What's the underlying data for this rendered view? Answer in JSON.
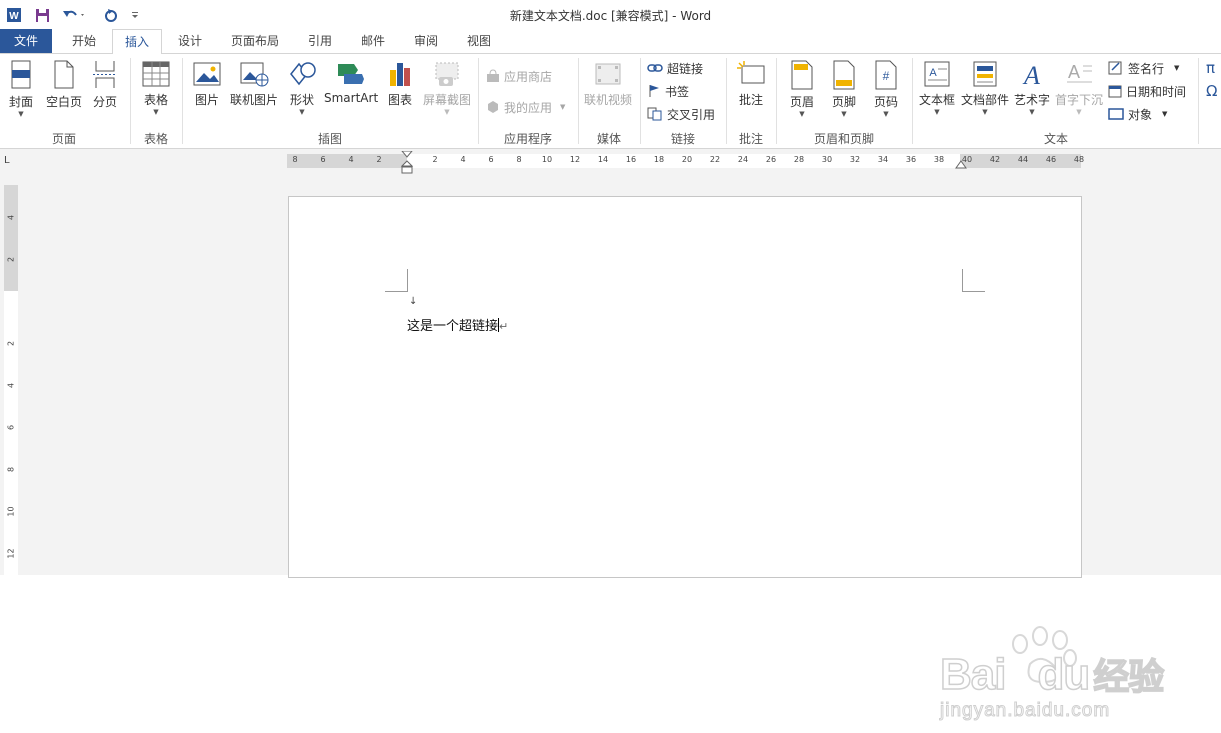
{
  "window": {
    "title": "新建文本文档.doc [兼容模式] - Word"
  },
  "quick_access": {
    "app_icon": "word-icon",
    "save_icon": "save-icon",
    "undo_icon": "undo-icon",
    "redo_icon": "redo-icon",
    "customize_icon": "customize-icon"
  },
  "tabs": [
    {
      "label": "文件",
      "active": false
    },
    {
      "label": "开始",
      "active": false
    },
    {
      "label": "插入",
      "active": true
    },
    {
      "label": "设计",
      "active": false
    },
    {
      "label": "页面布局",
      "active": false
    },
    {
      "label": "引用",
      "active": false
    },
    {
      "label": "邮件",
      "active": false
    },
    {
      "label": "审阅",
      "active": false
    },
    {
      "label": "视图",
      "active": false
    }
  ],
  "ribbon": {
    "groups": {
      "pages": "页面",
      "tables": "表格",
      "illustrations": "插图",
      "apps": "应用程序",
      "media": "媒体",
      "links": "链接",
      "comments": "批注",
      "header_footer": "页眉和页脚",
      "text": "文本"
    },
    "buttons": {
      "cover": "封面",
      "blank_page": "空白页",
      "page_break": "分页",
      "table": "表格",
      "picture": "图片",
      "online_picture": "联机图片",
      "shapes": "形状",
      "smartart": "SmartArt",
      "chart": "图表",
      "screenshot": "屏幕截图",
      "app_store": "应用商店",
      "my_apps": "我的应用",
      "online_video": "联机视频",
      "hyperlink": "超链接",
      "bookmark": "书签",
      "cross_reference": "交叉引用",
      "comment": "批注",
      "header": "页眉",
      "footer": "页脚",
      "page_number": "页码",
      "text_box": "文本框",
      "quick_parts": "文档部件",
      "wordart": "艺术字",
      "drop_cap": "首字下沉",
      "signature_line": "签名行",
      "date_time": "日期和时间",
      "object": "对象",
      "symbol_pi": "π",
      "symbol_omega": "Ω"
    }
  },
  "ruler": {
    "horizontal": [
      "8",
      "6",
      "4",
      "2",
      "2",
      "4",
      "6",
      "8",
      "10",
      "12",
      "14",
      "16",
      "18",
      "20",
      "22",
      "24",
      "26",
      "28",
      "30",
      "32",
      "34",
      "36",
      "38",
      "40",
      "42",
      "44",
      "46",
      "48"
    ],
    "vertical": [
      "4",
      "2",
      "2",
      "4",
      "6",
      "8",
      "10",
      "12"
    ],
    "tab_selector": "L"
  },
  "document": {
    "text": "这是一个超链接",
    "paragraph_mark": "↵",
    "line_break_mark": "↓"
  },
  "watermark": {
    "brand": "Bai",
    "brand_suffix": "du",
    "cn": "经验",
    "url": "jingyan.baidu.com"
  },
  "colors": {
    "accent": "#2b579a",
    "file_tab": "#2b579a"
  }
}
